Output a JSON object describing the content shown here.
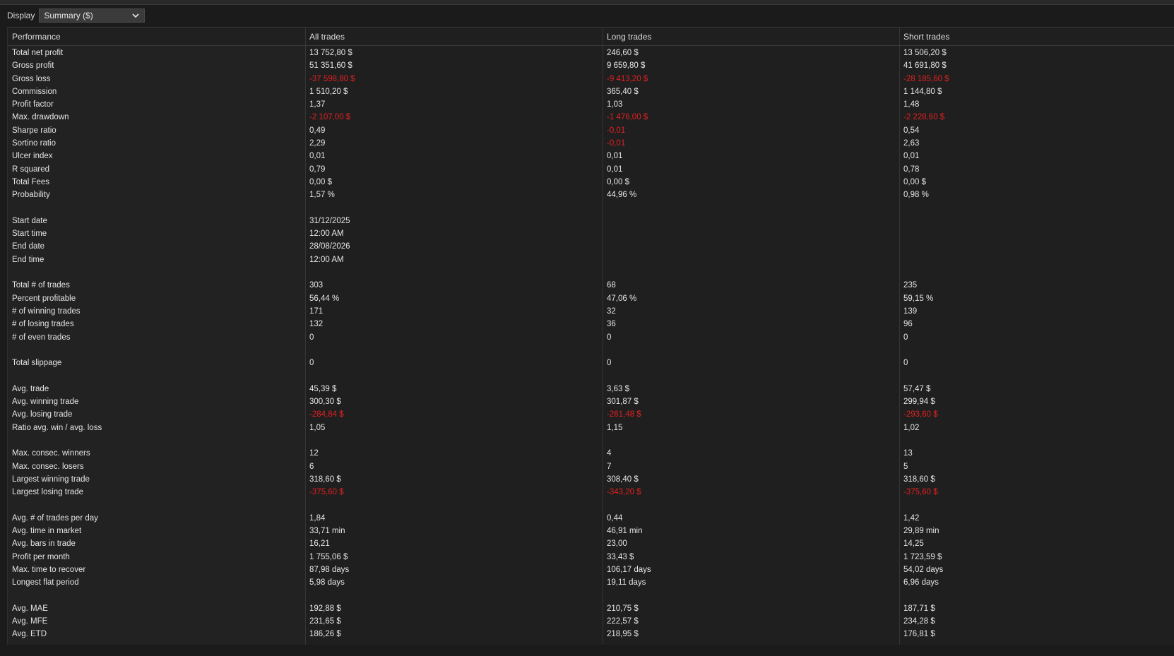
{
  "toolbar": {
    "display_label": "Display",
    "display_value": "Summary ($)"
  },
  "colors": {
    "negative": "#e02020",
    "background": "#1b1b1b",
    "text": "#e6e6e6"
  },
  "headers": [
    "Performance",
    "All trades",
    "Long trades",
    "Short trades"
  ],
  "rows": [
    {
      "label": "Total net profit",
      "values": [
        "13 752,80 $",
        "246,60 $",
        "13 506,20 $"
      ],
      "neg": [
        false,
        false,
        false
      ]
    },
    {
      "label": "Gross profit",
      "values": [
        "51 351,60 $",
        "9 659,80 $",
        "41 691,80 $"
      ],
      "neg": [
        false,
        false,
        false
      ]
    },
    {
      "label": "Gross loss",
      "values": [
        "-37 598,80 $",
        "-9 413,20 $",
        "-28 185,60 $"
      ],
      "neg": [
        true,
        true,
        true
      ]
    },
    {
      "label": "Commission",
      "values": [
        "1 510,20 $",
        "365,40 $",
        "1 144,80 $"
      ],
      "neg": [
        false,
        false,
        false
      ]
    },
    {
      "label": "Profit factor",
      "values": [
        "1,37",
        "1,03",
        "1,48"
      ],
      "neg": [
        false,
        false,
        false
      ]
    },
    {
      "label": "Max. drawdown",
      "values": [
        "-2 107,00 $",
        "-1 476,00 $",
        "-2 228,60 $"
      ],
      "neg": [
        true,
        true,
        true
      ]
    },
    {
      "label": "Sharpe ratio",
      "values": [
        "0,49",
        "-0,01",
        "0,54"
      ],
      "neg": [
        false,
        true,
        false
      ]
    },
    {
      "label": "Sortino ratio",
      "values": [
        "2,29",
        "-0,01",
        "2,63"
      ],
      "neg": [
        false,
        true,
        false
      ]
    },
    {
      "label": "Ulcer index",
      "values": [
        "0,01",
        "0,01",
        "0,01"
      ],
      "neg": [
        false,
        false,
        false
      ]
    },
    {
      "label": "R squared",
      "values": [
        "0,79",
        "0,01",
        "0,78"
      ],
      "neg": [
        false,
        false,
        false
      ]
    },
    {
      "label": "Total Fees",
      "values": [
        "0,00 $",
        "0,00 $",
        "0,00 $"
      ],
      "neg": [
        false,
        false,
        false
      ]
    },
    {
      "label": "Probability",
      "values": [
        "1,57 %",
        "44,96 %",
        "0,98 %"
      ],
      "neg": [
        false,
        false,
        false
      ]
    },
    {
      "label": "",
      "values": [
        "",
        "",
        ""
      ],
      "neg": [
        false,
        false,
        false
      ]
    },
    {
      "label": "Start date",
      "values": [
        "31/12/2025",
        "",
        ""
      ],
      "neg": [
        false,
        false,
        false
      ]
    },
    {
      "label": "Start time",
      "values": [
        "12:00 AM",
        "",
        ""
      ],
      "neg": [
        false,
        false,
        false
      ]
    },
    {
      "label": "End date",
      "values": [
        "28/08/2026",
        "",
        ""
      ],
      "neg": [
        false,
        false,
        false
      ]
    },
    {
      "label": "End time",
      "values": [
        "12:00 AM",
        "",
        ""
      ],
      "neg": [
        false,
        false,
        false
      ]
    },
    {
      "label": "",
      "values": [
        "",
        "",
        ""
      ],
      "neg": [
        false,
        false,
        false
      ]
    },
    {
      "label": "Total # of trades",
      "values": [
        "303",
        "68",
        "235"
      ],
      "neg": [
        false,
        false,
        false
      ]
    },
    {
      "label": "Percent profitable",
      "values": [
        "56,44 %",
        "47,06 %",
        "59,15 %"
      ],
      "neg": [
        false,
        false,
        false
      ]
    },
    {
      "label": "# of winning trades",
      "values": [
        "171",
        "32",
        "139"
      ],
      "neg": [
        false,
        false,
        false
      ]
    },
    {
      "label": "# of losing trades",
      "values": [
        "132",
        "36",
        "96"
      ],
      "neg": [
        false,
        false,
        false
      ]
    },
    {
      "label": "# of even trades",
      "values": [
        "0",
        "0",
        "0"
      ],
      "neg": [
        false,
        false,
        false
      ]
    },
    {
      "label": "",
      "values": [
        "",
        "",
        ""
      ],
      "neg": [
        false,
        false,
        false
      ]
    },
    {
      "label": "Total slippage",
      "values": [
        "0",
        "0",
        "0"
      ],
      "neg": [
        false,
        false,
        false
      ]
    },
    {
      "label": "",
      "values": [
        "",
        "",
        ""
      ],
      "neg": [
        false,
        false,
        false
      ]
    },
    {
      "label": "Avg. trade",
      "values": [
        "45,39 $",
        "3,63 $",
        "57,47 $"
      ],
      "neg": [
        false,
        false,
        false
      ]
    },
    {
      "label": "Avg. winning trade",
      "values": [
        "300,30 $",
        "301,87 $",
        "299,94 $"
      ],
      "neg": [
        false,
        false,
        false
      ]
    },
    {
      "label": "Avg. losing trade",
      "values": [
        "-284,84 $",
        "-261,48 $",
        "-293,60 $"
      ],
      "neg": [
        true,
        true,
        true
      ]
    },
    {
      "label": "Ratio avg. win / avg. loss",
      "values": [
        "1,05",
        "1,15",
        "1,02"
      ],
      "neg": [
        false,
        false,
        false
      ]
    },
    {
      "label": "",
      "values": [
        "",
        "",
        ""
      ],
      "neg": [
        false,
        false,
        false
      ]
    },
    {
      "label": "Max. consec. winners",
      "values": [
        "12",
        "4",
        "13"
      ],
      "neg": [
        false,
        false,
        false
      ]
    },
    {
      "label": "Max. consec. losers",
      "values": [
        "6",
        "7",
        "5"
      ],
      "neg": [
        false,
        false,
        false
      ]
    },
    {
      "label": "Largest winning trade",
      "values": [
        "318,60 $",
        "308,40 $",
        "318,60 $"
      ],
      "neg": [
        false,
        false,
        false
      ]
    },
    {
      "label": "Largest losing trade",
      "values": [
        "-375,60 $",
        "-343,20 $",
        "-375,60 $"
      ],
      "neg": [
        true,
        true,
        true
      ]
    },
    {
      "label": "",
      "values": [
        "",
        "",
        ""
      ],
      "neg": [
        false,
        false,
        false
      ]
    },
    {
      "label": "Avg. # of trades per day",
      "values": [
        "1,84",
        "0,44",
        "1,42"
      ],
      "neg": [
        false,
        false,
        false
      ]
    },
    {
      "label": "Avg. time in market",
      "values": [
        "33,71 min",
        "46,91 min",
        "29,89 min"
      ],
      "neg": [
        false,
        false,
        false
      ]
    },
    {
      "label": "Avg. bars in trade",
      "values": [
        "16,21",
        "23,00",
        "14,25"
      ],
      "neg": [
        false,
        false,
        false
      ]
    },
    {
      "label": "Profit per month",
      "values": [
        "1 755,06 $",
        "33,43 $",
        "1 723,59 $"
      ],
      "neg": [
        false,
        false,
        false
      ]
    },
    {
      "label": "Max. time to recover",
      "values": [
        "87,98 days",
        "106,17 days",
        "54,02 days"
      ],
      "neg": [
        false,
        false,
        false
      ]
    },
    {
      "label": "Longest flat period",
      "values": [
        "5,98 days",
        "19,11 days",
        "6,96 days"
      ],
      "neg": [
        false,
        false,
        false
      ]
    },
    {
      "label": "",
      "values": [
        "",
        "",
        ""
      ],
      "neg": [
        false,
        false,
        false
      ]
    },
    {
      "label": "Avg. MAE",
      "values": [
        "192,88 $",
        "210,75 $",
        "187,71 $"
      ],
      "neg": [
        false,
        false,
        false
      ]
    },
    {
      "label": "Avg. MFE",
      "values": [
        "231,65 $",
        "222,57 $",
        "234,28 $"
      ],
      "neg": [
        false,
        false,
        false
      ]
    },
    {
      "label": "Avg. ETD",
      "values": [
        "186,26 $",
        "218,95 $",
        "176,81 $"
      ],
      "neg": [
        false,
        false,
        false
      ]
    }
  ]
}
